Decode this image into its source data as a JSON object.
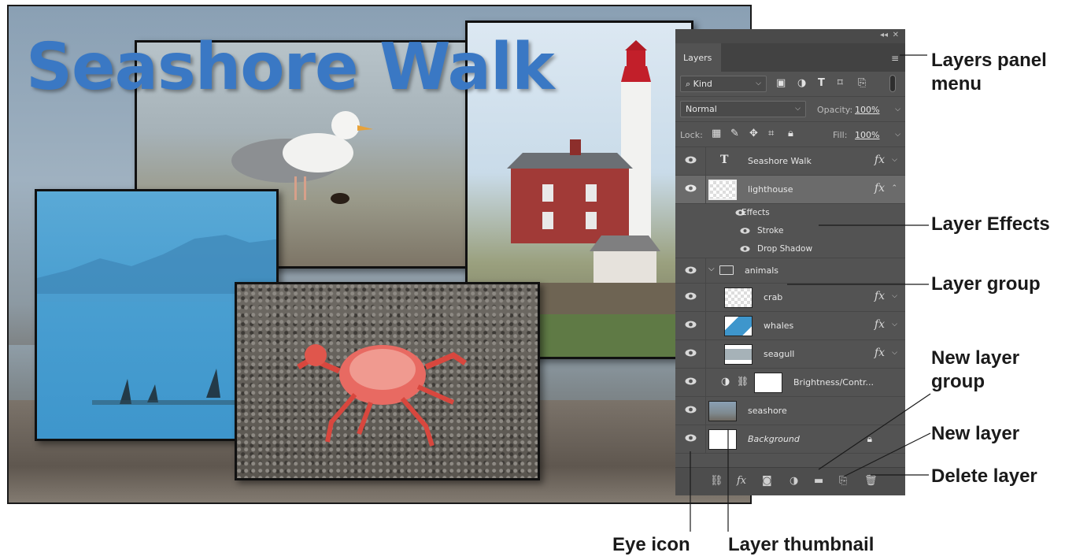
{
  "canvas": {
    "title_text": "Seashore Walk",
    "photos": [
      "seagull-photo",
      "lighthouse-photo",
      "whales-photo",
      "crab-photo"
    ]
  },
  "panel": {
    "tab_label": "Layers",
    "filter_kind": "Kind",
    "blend_mode": "Normal",
    "opacity_label": "Opacity:",
    "opacity_value": "100%",
    "lock_label": "Lock:",
    "fill_label": "Fill:",
    "fill_value": "100%",
    "layers": [
      {
        "name": "Seashore Walk",
        "type": "text",
        "fx": "fx"
      },
      {
        "name": "lighthouse",
        "type": "image",
        "fx": "fx",
        "selected": true
      },
      {
        "name": "Effects",
        "type": "effects-header"
      },
      {
        "name": "Stroke",
        "type": "effect"
      },
      {
        "name": "Drop Shadow",
        "type": "effect"
      },
      {
        "name": "animals",
        "type": "group"
      },
      {
        "name": "crab",
        "type": "image",
        "fx": "fx"
      },
      {
        "name": "whales",
        "type": "image",
        "fx": "fx"
      },
      {
        "name": "seagull",
        "type": "image",
        "fx": "fx"
      },
      {
        "name": "Brightness/Contr...",
        "type": "adjustment"
      },
      {
        "name": "seashore",
        "type": "image"
      },
      {
        "name": "Background",
        "type": "background"
      }
    ]
  },
  "callouts": {
    "panel_menu": "Layers panel\nmenu",
    "panel_menu_line1": "Layers panel",
    "panel_menu_line2": "menu",
    "layer_effects": "Layer Effects",
    "layer_group": "Layer group",
    "new_layer_group_line1": "New layer",
    "new_layer_group_line2": "group",
    "new_layer": "New layer",
    "delete_layer": "Delete layer",
    "eye_icon": "Eye icon",
    "layer_thumbnail": "Layer thumbnail"
  },
  "colors": {
    "panel_bg": "#535353",
    "selected_row": "#6b6b6b",
    "title_blue": "#3a78c4"
  }
}
